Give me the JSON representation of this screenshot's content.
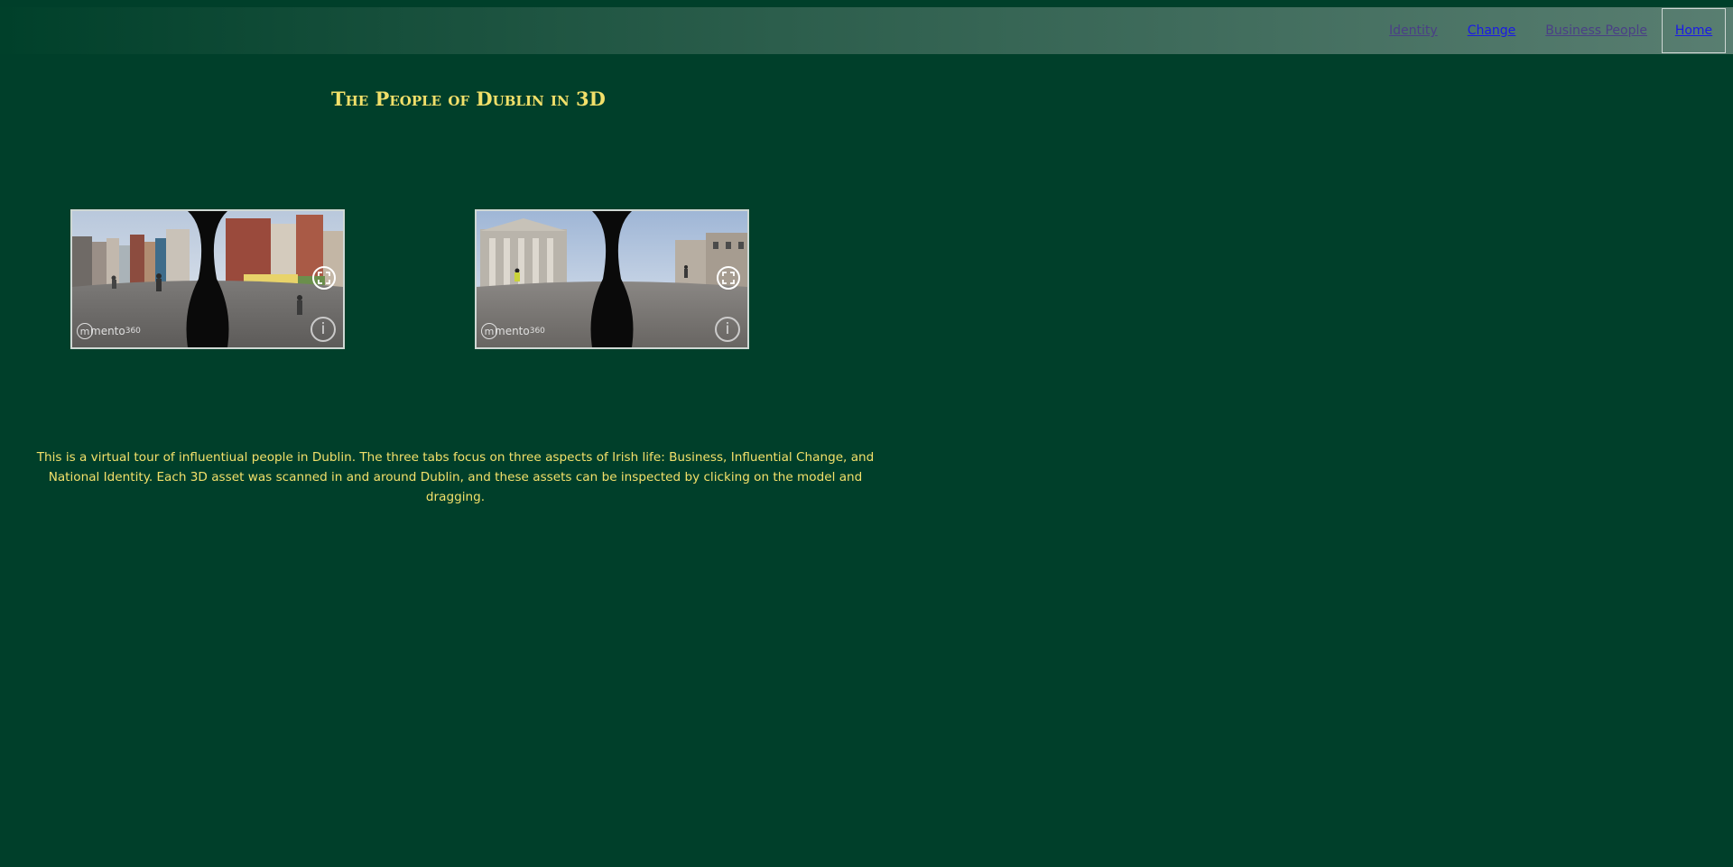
{
  "nav": {
    "items": [
      {
        "label": "Identity",
        "state": "visited"
      },
      {
        "label": "Change",
        "state": "active"
      },
      {
        "label": "Business People",
        "state": "visited"
      }
    ],
    "home_label": "Home"
  },
  "header": {
    "title": "The People of Dublin in 3D"
  },
  "tours": [
    {
      "brand_text": "mento",
      "brand_suffix": "360",
      "brand_mark": "m",
      "fullscreen_icon": "fullscreen-icon",
      "info_label": "i"
    },
    {
      "brand_text": "mento",
      "brand_suffix": "360",
      "brand_mark": "m",
      "fullscreen_icon": "fullscreen-icon",
      "info_label": "i"
    }
  ],
  "description": "This is a virtual tour of influentiual people in Dublin. The three tabs focus on three aspects of Irish life: Business, Influential Change, and National Identity. Each 3D asset was scanned in and around Dublin, and these assets can be inspected by clicking on the model and dragging.",
  "colors": {
    "background": "#003f2a",
    "accent_text": "#f2e06a",
    "link_visited": "#4a3f86",
    "link_active": "#1a1ae6"
  }
}
